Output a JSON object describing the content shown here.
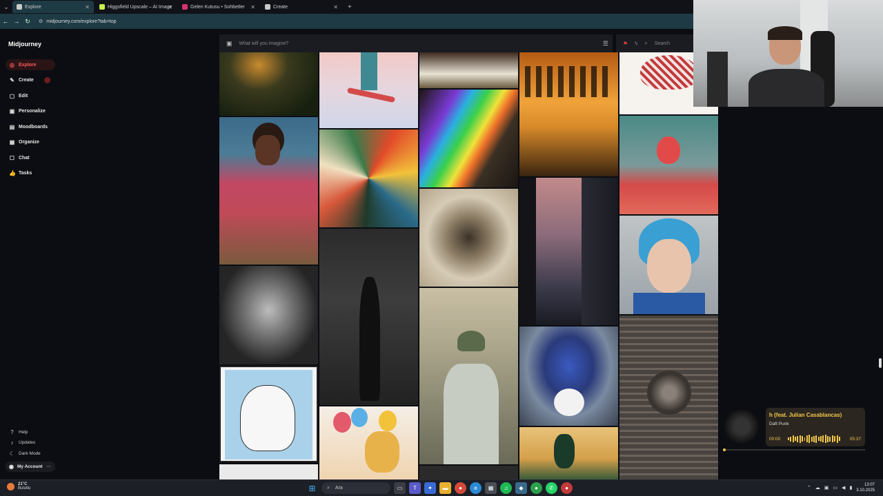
{
  "browser": {
    "tabs": [
      {
        "label": "Explore",
        "favicon_color": "#c9c9c9",
        "active": true
      },
      {
        "label": "Higgsfield Upscale – AI Image",
        "favicon_color": "#c6f04a",
        "active": false
      },
      {
        "label": "Gelen Kutusu • Sohbetler",
        "favicon_color": "#d9316f",
        "active": false
      },
      {
        "label": "Create",
        "favicon_color": "#c9c9c9",
        "active": false
      }
    ],
    "url": "midjourney.com/explore?tab=top"
  },
  "sidebar": {
    "brand": "Midjourney",
    "items": [
      {
        "label": "Explore",
        "icon": "compass-icon"
      },
      {
        "label": "Create",
        "icon": "brush-icon"
      },
      {
        "label": "Edit",
        "icon": "edit-icon"
      },
      {
        "label": "Personalize",
        "icon": "personalize-icon"
      },
      {
        "label": "Moodboards",
        "icon": "moodboard-icon"
      },
      {
        "label": "Organize",
        "icon": "grid-icon"
      },
      {
        "label": "Chat",
        "icon": "chat-icon"
      },
      {
        "label": "Tasks",
        "icon": "thumbs-up-icon"
      }
    ],
    "bottom": [
      {
        "label": "Help",
        "icon": "help-icon"
      },
      {
        "label": "Updates",
        "icon": "bell-icon"
      },
      {
        "label": "Dark Mode",
        "icon": "moon-icon"
      }
    ],
    "account": "My Account"
  },
  "search": {
    "placeholder": "What will you imagine?",
    "right_placeholder": "Search"
  },
  "player": {
    "song": "h (feat. Julian Casablancas)",
    "artist": "Daft Punk",
    "elapsed": "00:00",
    "duration": "05:37",
    "accent": "#f4c84a"
  },
  "taskbar": {
    "temperature": "21°C",
    "weather_text": "Bulutlu",
    "search_label": "Ara",
    "time": "13:07",
    "date": "3.10.2025"
  },
  "colors": {
    "active_red": "#ff5a5a",
    "page_bg": "#0b0d12"
  }
}
